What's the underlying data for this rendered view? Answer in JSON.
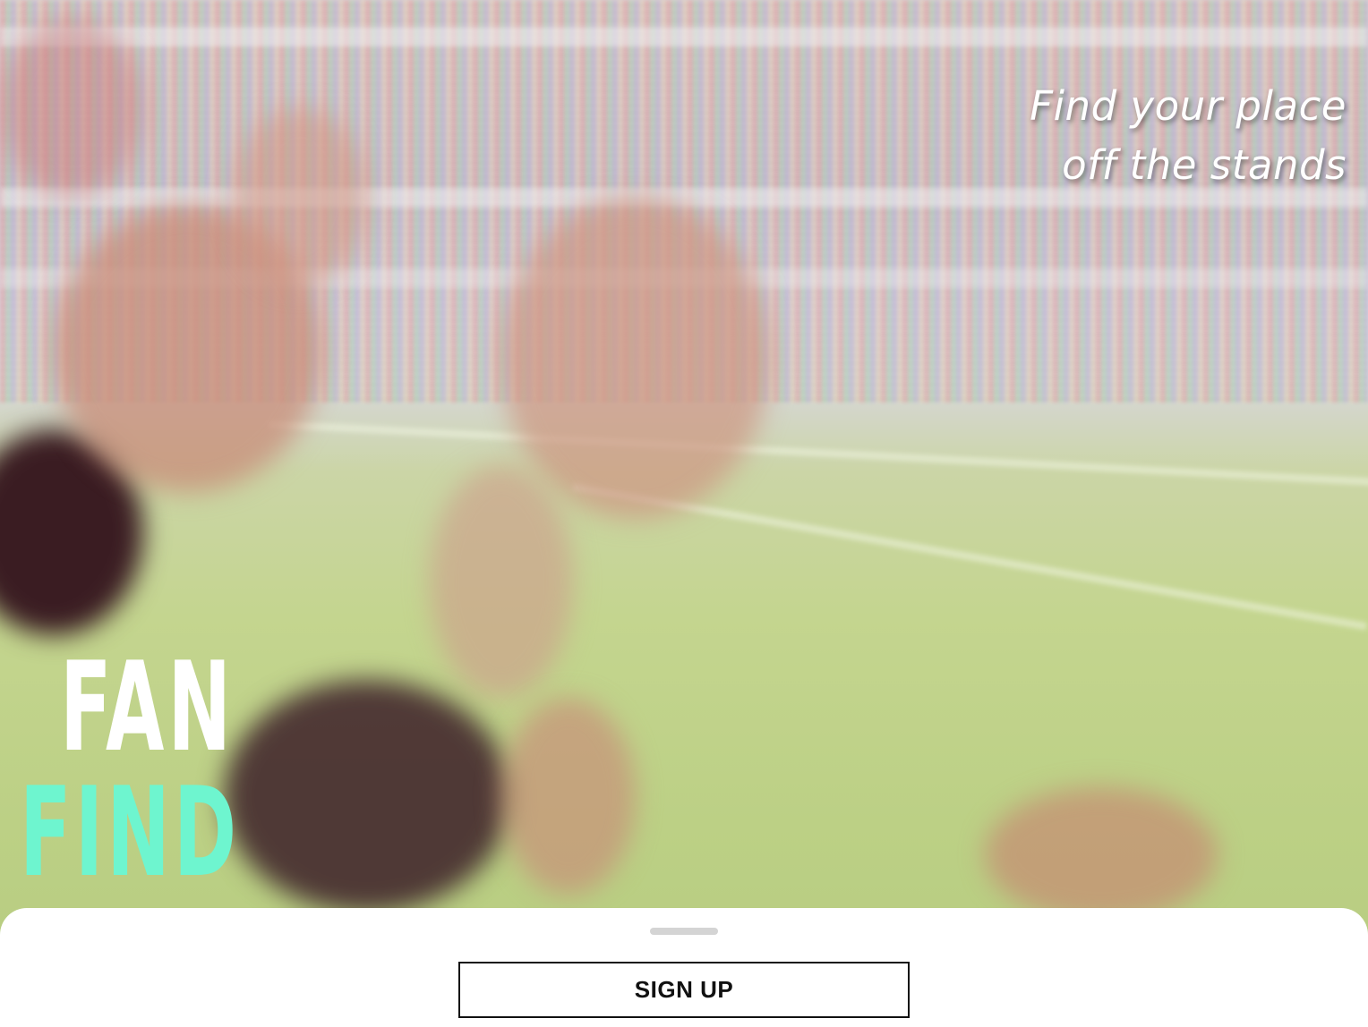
{
  "hero": {
    "tagline_line1": "Find your place",
    "tagline_line2": "off the stands"
  },
  "logo": {
    "word1": "FAN",
    "word2": "FIND",
    "accent_color": "#6ef5cf"
  },
  "bottom_sheet": {
    "signup_label": "SIGN UP"
  }
}
